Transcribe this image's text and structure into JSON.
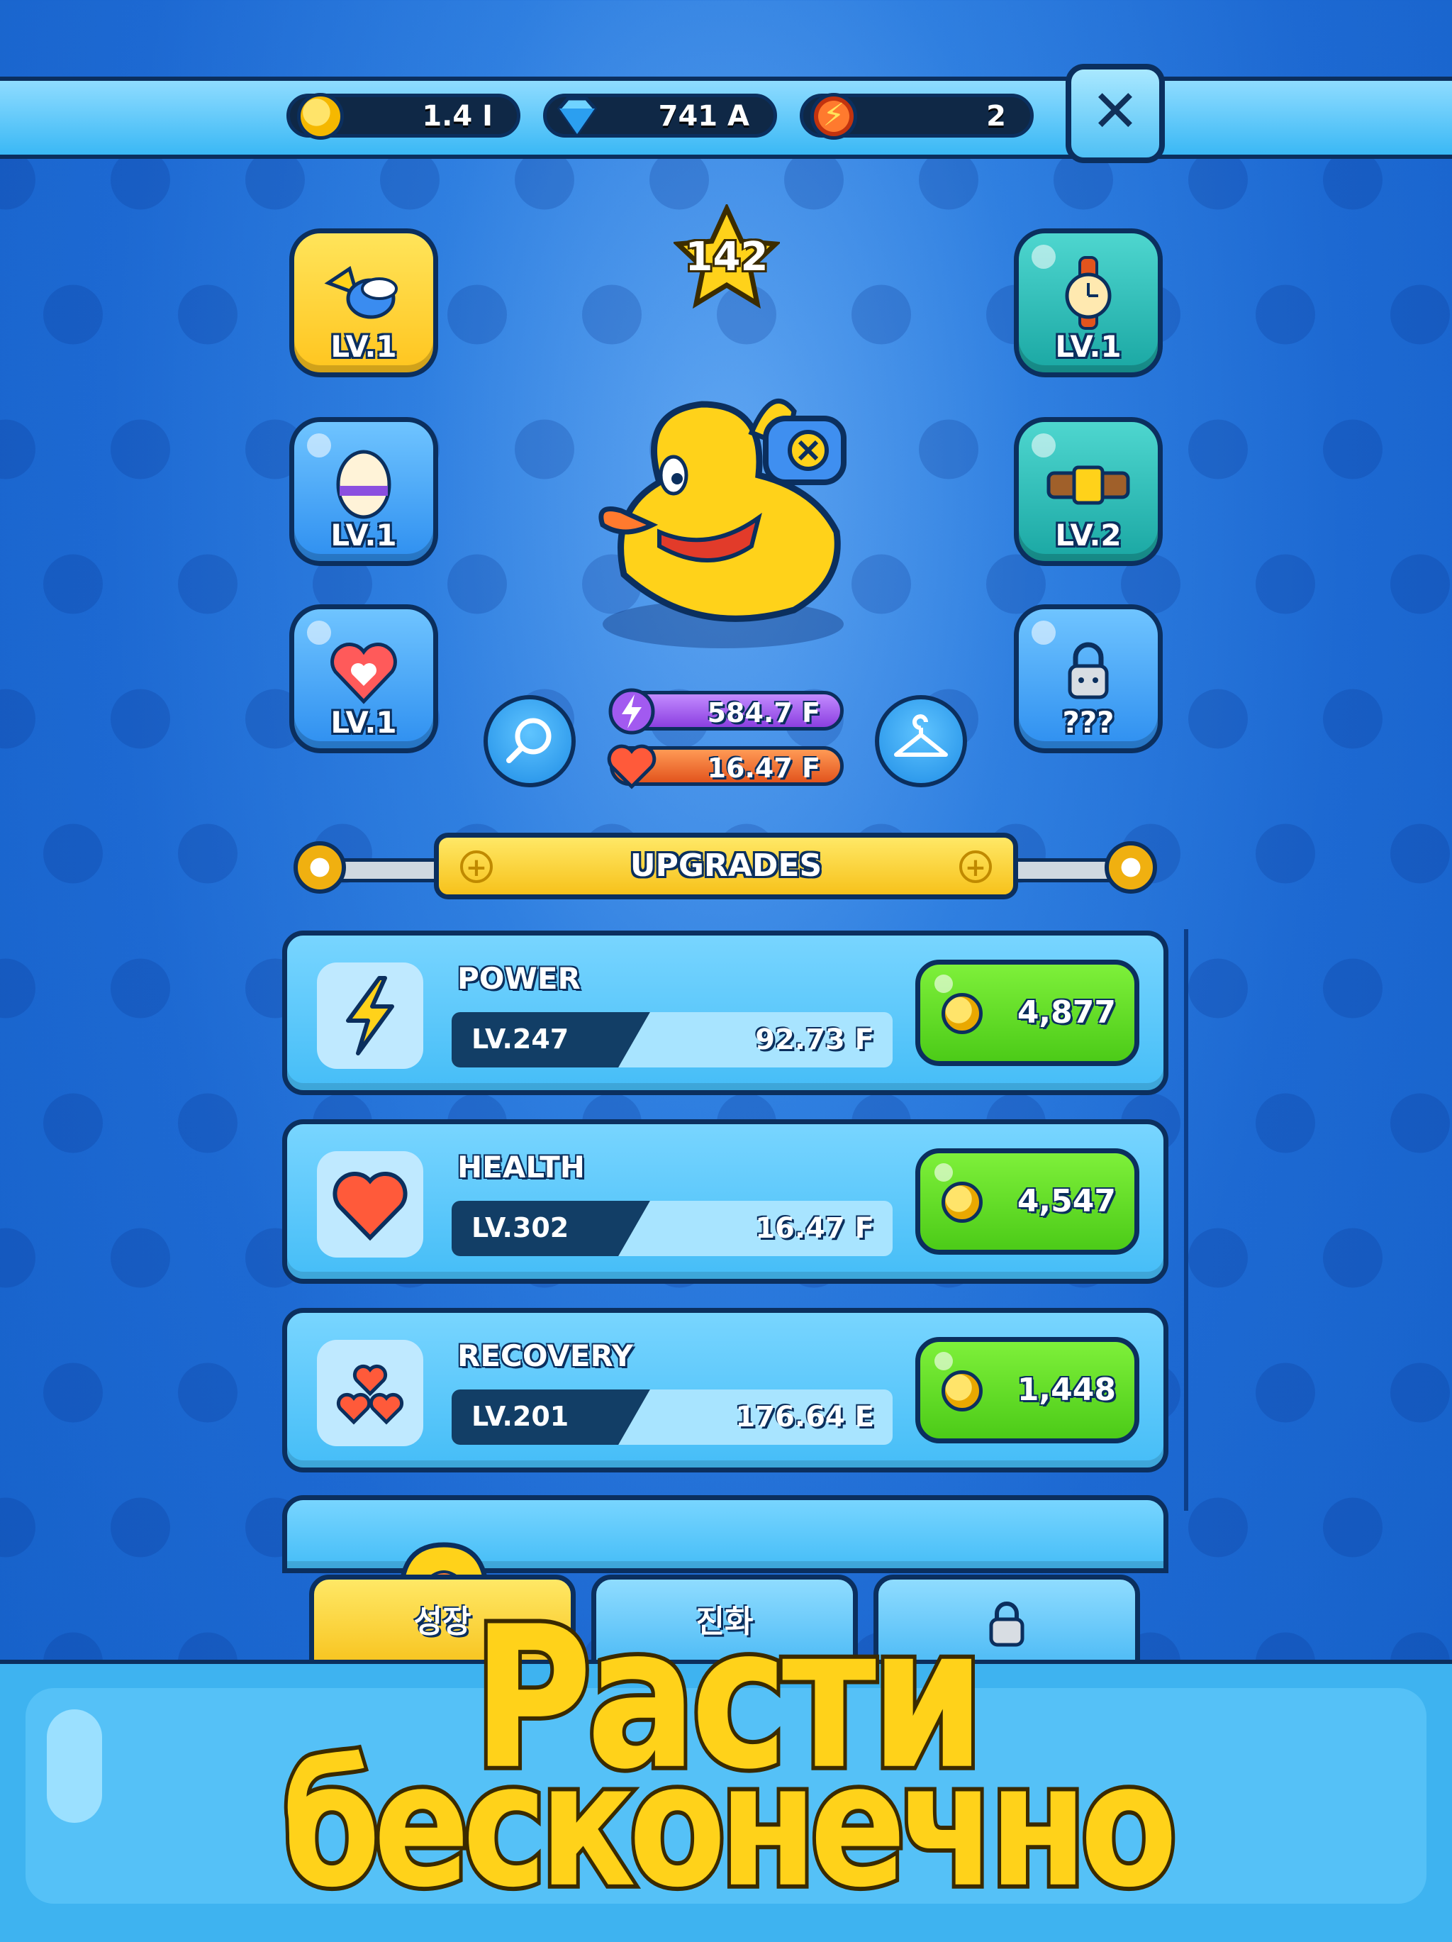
{
  "currencies": {
    "coins": "1.4 I",
    "gems": "741 A",
    "energy": "2"
  },
  "header": {
    "close_label": "✕"
  },
  "equipment": {
    "left": [
      {
        "level": "LV.1",
        "icon": "bird-icon",
        "color": "yellow"
      },
      {
        "level": "LV.1",
        "icon": "egg-icon",
        "color": "blue"
      },
      {
        "level": "LV.1",
        "icon": "heart-badge-icon",
        "color": "blue"
      }
    ],
    "right": [
      {
        "level": "LV.1",
        "icon": "watch-icon",
        "color": "teal"
      },
      {
        "level": "LV.2",
        "icon": "belt-icon",
        "color": "teal"
      },
      {
        "level": "???",
        "icon": "lock-icon",
        "color": "blue"
      }
    ]
  },
  "character": {
    "rank": "142",
    "power": "584.7 F",
    "health": "16.47 F"
  },
  "upgrades": {
    "title": "UPGRADES",
    "items": [
      {
        "name": "POWER",
        "level": "LV.247",
        "value": "92.73 F",
        "price": "4,877",
        "icon": "lightning-icon",
        "progress": 0.45
      },
      {
        "name": "HEALTH",
        "level": "LV.302",
        "value": "16.47 F",
        "price": "4,547",
        "icon": "heart-icon",
        "progress": 0.45
      },
      {
        "name": "RECOVERY",
        "level": "LV.201",
        "value": "176.64 E",
        "price": "1,448",
        "icon": "hearts-icon",
        "progress": 0.45
      }
    ]
  },
  "tabs": [
    {
      "label": "성장",
      "active": true
    },
    {
      "label": "진화",
      "active": false
    },
    {
      "label": "",
      "icon": "lock-icon",
      "active": false
    }
  ],
  "promo": {
    "line1": "Расти",
    "line2": "бесконечно"
  },
  "colors": {
    "background": "#1d69d2",
    "accent_yellow": "#ffc51e",
    "buy_green": "#4ccb18",
    "outline": "#0b2f5e"
  }
}
